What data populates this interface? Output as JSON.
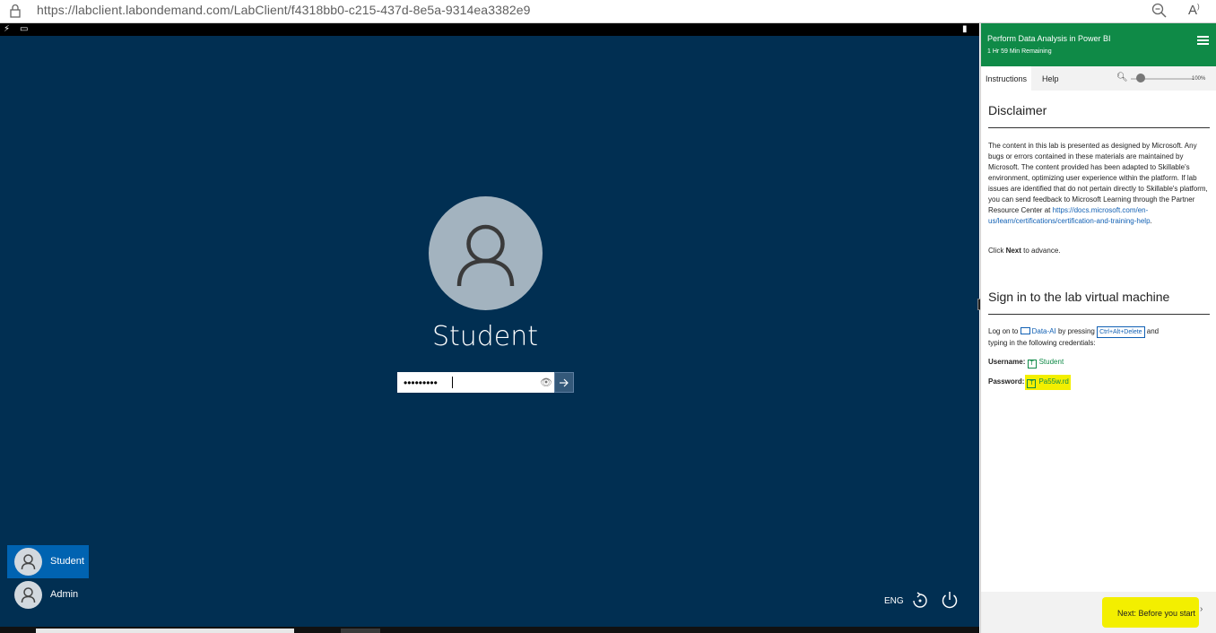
{
  "browser": {
    "url": "https://labclient.labondemand.com/LabClient/f4318bb0-c215-437d-8e5a-9314ea3382e9"
  },
  "vm": {
    "user_name": "Student",
    "password_mask": "•••••••••",
    "accounts": [
      {
        "label": "Student",
        "selected": true
      },
      {
        "label": "Admin",
        "selected": false
      }
    ],
    "language": "ENG"
  },
  "panel": {
    "title": "Perform Data Analysis in Power BI",
    "time_remaining": "1 Hr 59 Min Remaining",
    "tabs": [
      "Instructions",
      "Help"
    ],
    "zoom": "100%",
    "disclaimer_heading": "Disclaimer",
    "disclaimer_text": "The content in this lab is presented as designed by Microsoft. Any bugs or errors contained in these materials are maintained by Microsoft. The content provided has been adapted to Skillable's environment, optimizing user experience within the platform. If lab issues are identified that do not pertain directly to Skillable's platform, you can send feedback to Microsoft Learning through the Partner Resource Center at ",
    "disclaimer_link": "https://docs.microsoft.com/en-us/learn/certifications/certification-and-training-help",
    "advance_pre": "Click ",
    "advance_bold": "Next",
    "advance_post": " to advance.",
    "signin_heading": "Sign in to the lab virtual machine",
    "logon_pre": "Log on to ",
    "logon_vm": "Data-AI",
    "logon_mid": " by pressing ",
    "logon_keys": "Ctrl+Alt+Delete",
    "logon_post1": " and",
    "logon_post2": "typing in the following credentials:",
    "username_label": "Username:",
    "username_value": "Student",
    "password_label": "Password:",
    "password_value": "Pa55w.rd",
    "next_label": "Next: Before you start"
  },
  "colors": {
    "vm_background": "#012f52",
    "panel_header": "#0f8a47",
    "highlight": "#f3ef00",
    "selected_account": "#0063b1"
  }
}
